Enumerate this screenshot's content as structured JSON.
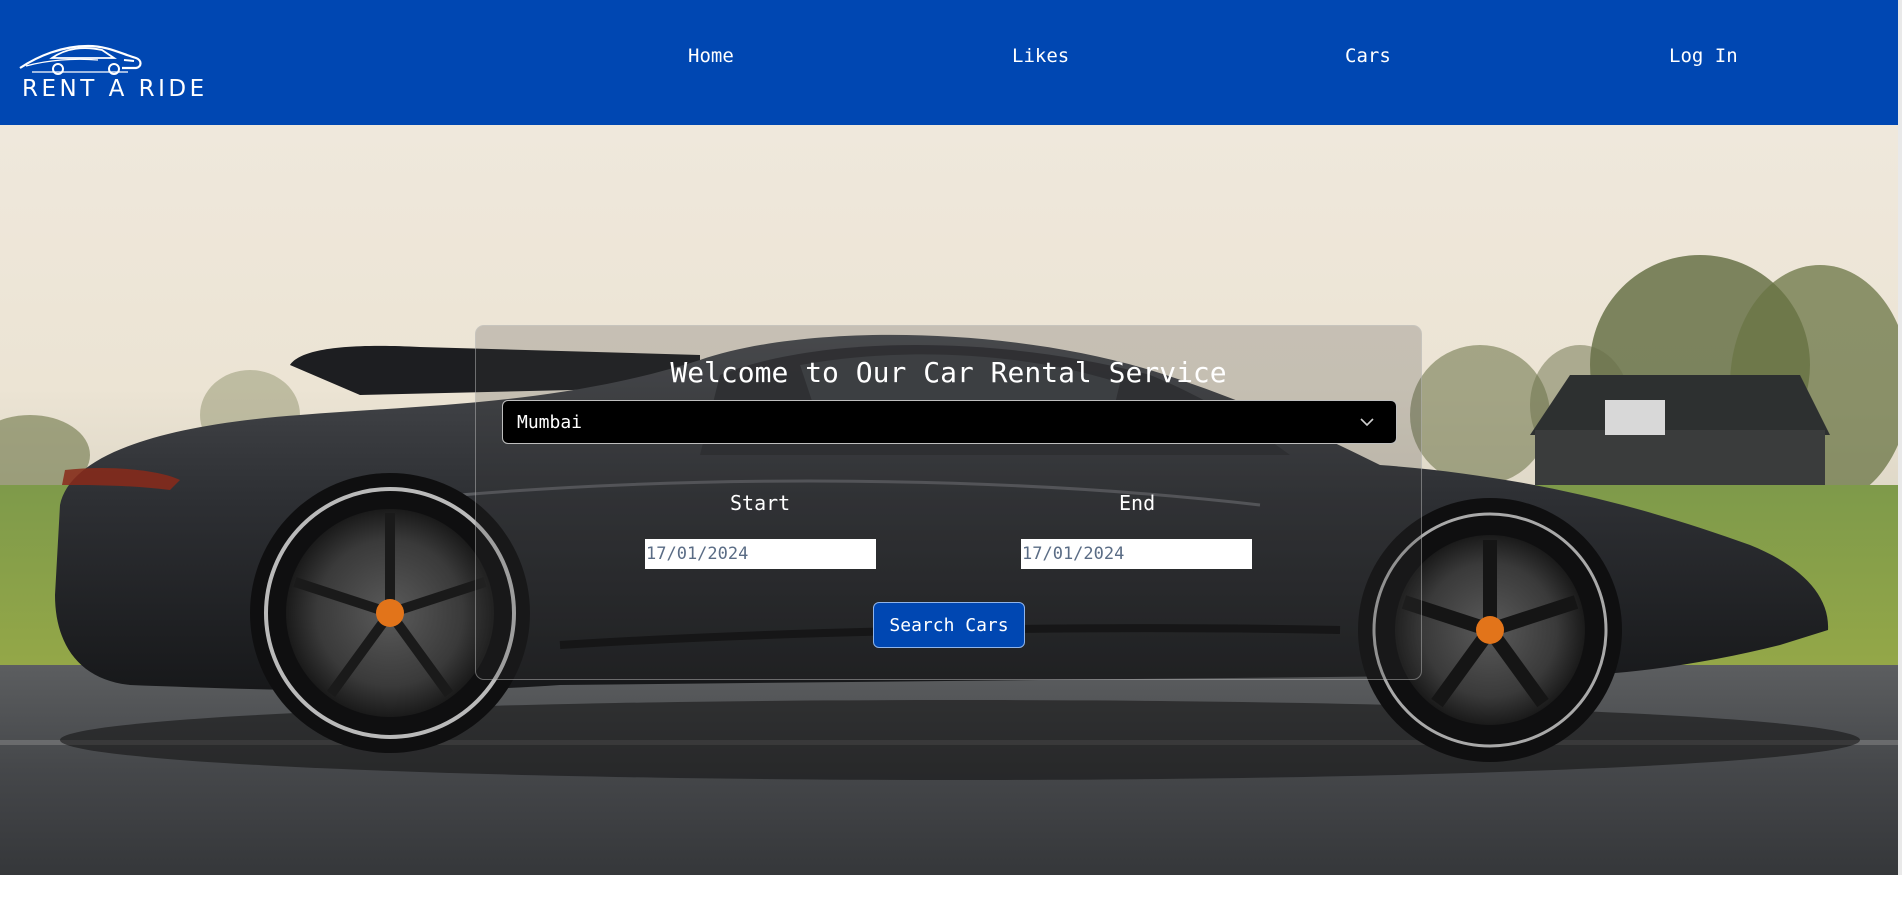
{
  "header": {
    "brand": "RENT A RIDE",
    "logo_icon": "car-icon",
    "nav": [
      {
        "label": "Home"
      },
      {
        "label": "Likes"
      },
      {
        "label": "Cars"
      },
      {
        "label": "Log In"
      }
    ],
    "background_color": "#0047b2"
  },
  "hero": {
    "image": "sports-car-photo",
    "title": "Welcome to Our Car Rental Service",
    "city_select": {
      "value": "Mumbai",
      "icon": "chevron-down-icon"
    },
    "start": {
      "label": "Start",
      "value": "17/01/2024"
    },
    "end": {
      "label": "End",
      "value": "17/01/2024"
    },
    "search_button": "Search Cars"
  }
}
